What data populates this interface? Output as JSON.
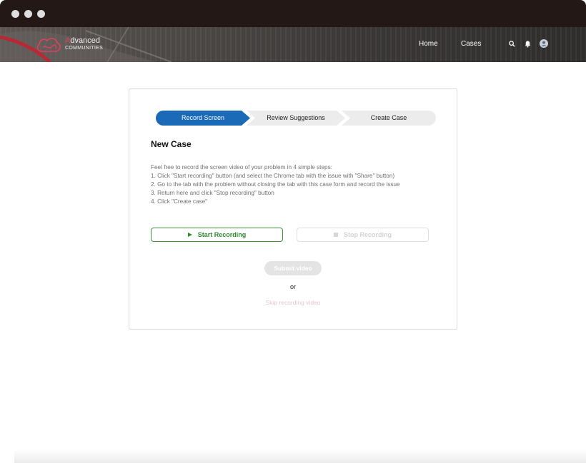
{
  "window": {
    "controls": [
      "close",
      "minimize",
      "maximize"
    ]
  },
  "header": {
    "brand_name_first": "A",
    "brand_name_rest": "dvanced",
    "brand_tagline": "COMMUNITIES",
    "nav": {
      "home": "Home",
      "cases": "Cases"
    },
    "icons": [
      "search-icon",
      "bell-icon",
      "user-avatar-icon"
    ]
  },
  "steps": [
    {
      "label": "Record Screen",
      "active": true
    },
    {
      "label": "Review Suggestions",
      "active": false
    },
    {
      "label": "Create Case",
      "active": false
    }
  ],
  "form": {
    "title": "New Case",
    "instructions": [
      "Feel free to record the screen video of your problem in 4 simple steps:",
      "1. Click \"Start recording\" button (and select the Chrome tab with the issue with \"Share\" button)",
      "2. Go to the tab with the problem without closing the tab with this case form and record the issue",
      "3. Return here and click \"Stop recording\" button",
      "4. Click \"Create case\""
    ],
    "start_label": "Start Recording",
    "stop_label": "Stop Recording",
    "submit_label": "Submit video",
    "or_text": "or",
    "skip_label": "Skip recording video"
  },
  "colors": {
    "active_step": "#1a6ab8",
    "start_green": "#2e8b2e",
    "brand_pink": "#e0405a",
    "titlebar": "#231816"
  }
}
